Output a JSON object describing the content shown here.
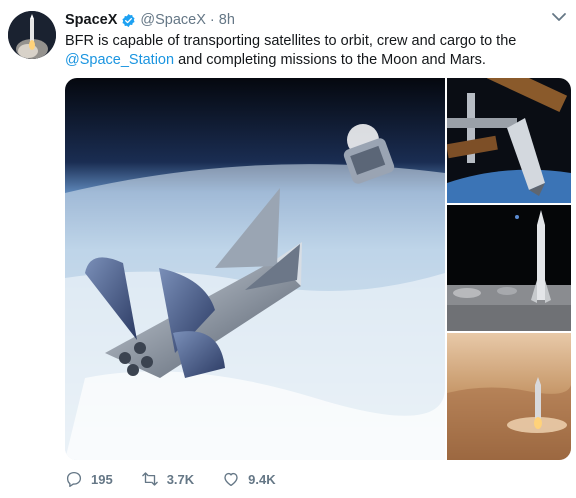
{
  "tweet": {
    "author_name": "SpaceX",
    "handle": "@SpaceX",
    "separator": "·",
    "time": "8h",
    "text_before": "BFR is capable of transporting satellites to orbit, crew and cargo to the ",
    "mention": "@Space_Station",
    "text_after": " and completing missions to the Moon and Mars."
  },
  "actions": {
    "reply_count": "195",
    "retweet_count": "3.7K",
    "like_count": "9.4K"
  },
  "icons": {
    "verified": "verified-badge-icon",
    "menu": "chevron-down-icon",
    "reply": "reply-icon",
    "retweet": "retweet-icon",
    "like": "heart-icon"
  },
  "colors": {
    "link": "#1b95e0",
    "secondary": "#657786",
    "verified": "#1da1f2"
  }
}
